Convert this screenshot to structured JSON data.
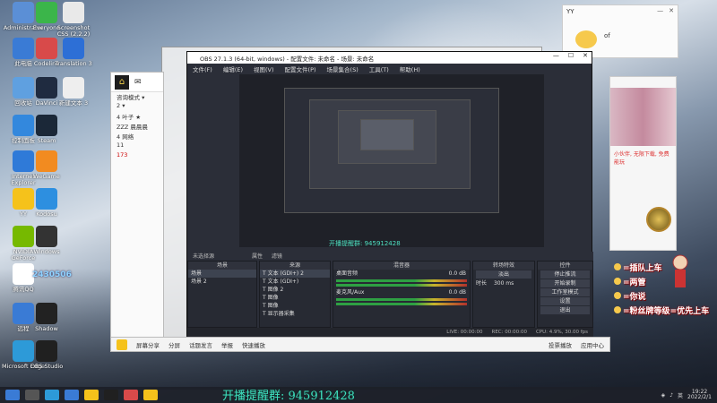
{
  "desktop": {
    "icons": [
      {
        "label": "Administrator",
        "color": "#5b8fd6"
      },
      {
        "label": "Everyone",
        "color": "#3bb54a"
      },
      {
        "label": "Screenshot CSS (2.2.2)",
        "color": "#e9e9e9"
      },
      {
        "label": "此电脑",
        "color": "#3a7bd5"
      },
      {
        "label": "Codeline",
        "color": "#d84a4a"
      },
      {
        "label": "Translation 3",
        "color": "#2d6fd6"
      },
      {
        "label": "回收站",
        "color": "#5fa0e0"
      },
      {
        "label": "DaVinci",
        "color": "#1f2b40"
      },
      {
        "label": "新建文本 3",
        "color": "#eeeeee"
      },
      {
        "label": "控制面板",
        "color": "#3388dd"
      },
      {
        "label": "Steam",
        "color": "#1b2838"
      },
      {
        "label": "Internet Explorer",
        "color": "#2f7ad8"
      },
      {
        "label": "WeGame",
        "color": "#f28b20"
      },
      {
        "label": "YY",
        "color": "#f5c21b"
      },
      {
        "label": "Kodosu",
        "color": "#2d8fe0"
      },
      {
        "label": "NVIDIA GeForce",
        "color": "#76b900"
      },
      {
        "label": "Windows",
        "color": "#333333"
      },
      {
        "label": "腾讯QQ",
        "color": "#ffffff"
      },
      {
        "label": "远程",
        "color": "#3a7bd5"
      },
      {
        "label": "Shadow",
        "color": "#222222"
      },
      {
        "label": "Microsoft Edge",
        "color": "#2d9ad8"
      },
      {
        "label": "OBS Studio",
        "color": "#202020"
      }
    ],
    "qq_number_text": "2430506"
  },
  "qq_list": {
    "rows": [
      "咨询模式 ▾",
      "2 ▾",
      "4 叶子 ★",
      "ZZZ 晨晨晨",
      "4 网络",
      "11",
      "173"
    ]
  },
  "chat_window": {
    "title": "YY",
    "subtitle": "of"
  },
  "live_panel": {
    "ad_text": "小伙伴, 无限下载, 免费能玩"
  },
  "danmaku": [
    "插队上车",
    "两管",
    "你说",
    "粉丝牌等级=优先上车"
  ],
  "obs": {
    "title": "OBS 27.1.3 (64-bit, windows) - 配置文件: 未命名 - 场景: 未命名",
    "menu": [
      "文件(F)",
      "编辑(E)",
      "视图(V)",
      "配置文件(P)",
      "场景集合(S)",
      "工具(T)",
      "帮助(H)"
    ],
    "preview_caption": "开播提醒群: 945912428",
    "studio_label": "未选择源",
    "tabs": [
      "属性",
      "滤镜"
    ],
    "scenes": {
      "header": "场景",
      "items": [
        "场景",
        "场景 2"
      ]
    },
    "sources": {
      "header": "来源",
      "items": [
        "文本 (GDI+) 2",
        "文本 (GDI+)",
        "图像 2",
        "图像",
        "图像",
        "显示器采集"
      ]
    },
    "mixer": {
      "header": "混音器",
      "tracks": [
        "桌面音频",
        "麦克风/Aux"
      ],
      "levels": [
        "0.0 dB",
        "0.0 dB"
      ]
    },
    "transitions": {
      "header": "转场特效",
      "type": "淡出",
      "duration_label": "时长",
      "duration": "300 ms"
    },
    "controls": {
      "header": "控件",
      "buttons": [
        "停止推流",
        "开始录制",
        "工作室模式",
        "设置",
        "退出"
      ]
    },
    "status": [
      "LIVE: 00:00:00",
      "REC: 00:00:00",
      "CPU: 4.9%, 30.00 fps"
    ]
  },
  "qq_bottom": {
    "items": [
      "屏幕分享",
      "分屏",
      "话题发言",
      "举报",
      "快速播放"
    ],
    "right": [
      "投票播放",
      "应用中心"
    ]
  },
  "banner": "开播提醒群: 945912428",
  "taskbar": {
    "time": "19:22",
    "date": "2022/2/1",
    "lang": "英"
  }
}
